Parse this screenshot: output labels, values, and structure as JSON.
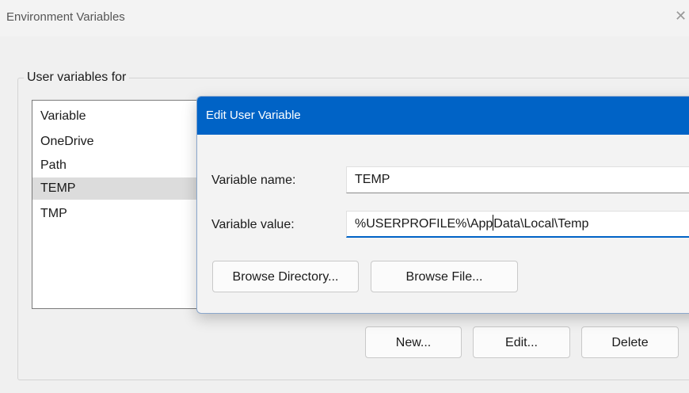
{
  "outer_window": {
    "title": "Environment Variables",
    "close_glyph": "✕",
    "group_label": "User variables for",
    "list_items": [
      "Variable",
      "OneDrive",
      "Path",
      "TEMP",
      "TMP"
    ],
    "selected_item": "TEMP",
    "buttons": {
      "new": "New...",
      "edit": "Edit...",
      "delete": "Delete"
    }
  },
  "dialog": {
    "title": "Edit User Variable",
    "name_label": "Variable name:",
    "name_value": "TEMP",
    "value_label": "Variable value:",
    "value_before_caret": "%USERPROFILE%\\App",
    "value_after_caret": "Data\\Local\\Temp",
    "browse_directory": "Browse Directory...",
    "browse_file": "Browse File...",
    "accent_color": "#0063c6"
  }
}
